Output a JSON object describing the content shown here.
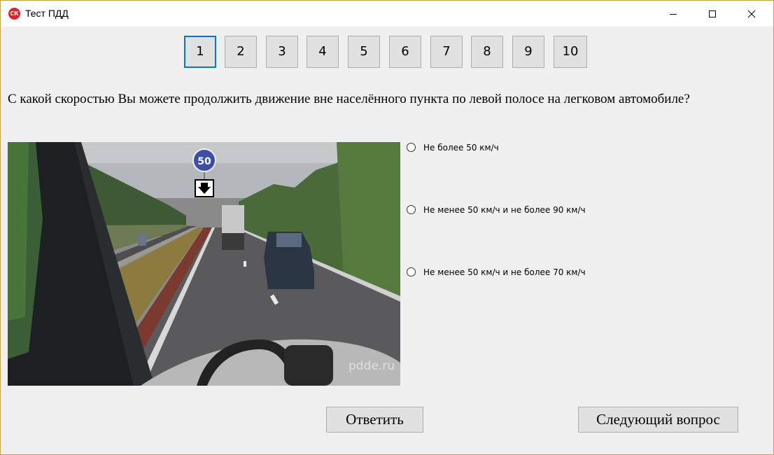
{
  "window": {
    "title": "Тест ПДД",
    "icon_text": "СК"
  },
  "question_nav": {
    "items": [
      "1",
      "2",
      "3",
      "4",
      "5",
      "6",
      "7",
      "8",
      "9",
      "10"
    ],
    "active_index": 0
  },
  "question": {
    "text": "С какой скоростью Вы можете продолжить движение вне населённого пункта по левой полосе на легковом автомобиле?"
  },
  "image": {
    "sign_speed": "50",
    "watermark": "pdde.ru"
  },
  "answers": [
    {
      "label": "Не более 50 км/ч",
      "selected": false
    },
    {
      "label": "Не менее 50 км/ч и не более 90 км/ч",
      "selected": false
    },
    {
      "label": "Не менее 50 км/ч и не более 70 км/ч",
      "selected": false
    }
  ],
  "buttons": {
    "answer_label": "Ответить",
    "next_label": "Следующий вопрос"
  },
  "colors": {
    "active_accent": "#0078d7",
    "background": "#f0f0f0",
    "button_face": "#e1e1e1",
    "icon_red": "#d9262c"
  }
}
